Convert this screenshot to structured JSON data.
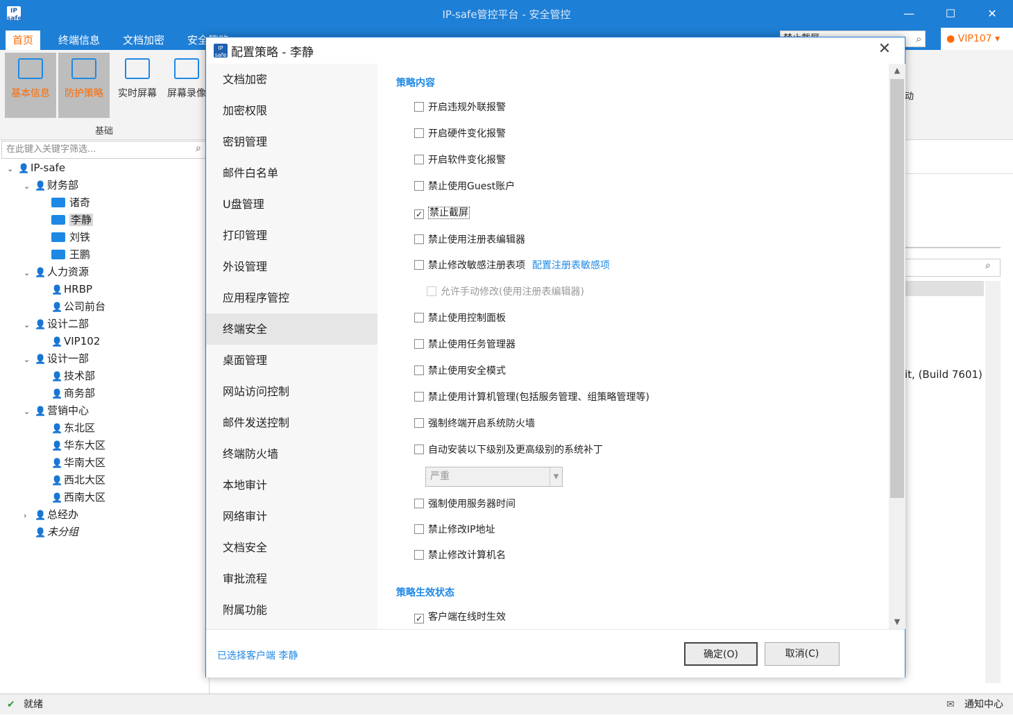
{
  "window": {
    "title": "IP-safe管控平台 - 安全管控",
    "logo": "IP safe"
  },
  "menu_tabs": [
    {
      "label": "首页"
    },
    {
      "label": "终端信息"
    },
    {
      "label": "文档加密"
    },
    {
      "label": "安全策略"
    }
  ],
  "search": {
    "value": "禁止截屏"
  },
  "user": {
    "label": "VIP107 ▾"
  },
  "ribbon": {
    "buttons": [
      "基本信息",
      "防护策略",
      "实时屏幕",
      "屏幕录像"
    ],
    "group_label": "基础"
  },
  "filter": {
    "placeholder": "在此键入关键字筛选..."
  },
  "tree": [
    {
      "label": "IP-safe",
      "kind": "group",
      "arrow": "⌄"
    },
    {
      "label": "财务部",
      "kind": "group",
      "arrow": "⌄"
    },
    {
      "label": "诸奇",
      "kind": "pc"
    },
    {
      "label": "李静",
      "kind": "pc"
    },
    {
      "label": "刘铁",
      "kind": "pc"
    },
    {
      "label": "王鹏",
      "kind": "pc"
    },
    {
      "label": "人力资源",
      "kind": "group",
      "arrow": "⌄"
    },
    {
      "label": "HRBP",
      "kind": "user"
    },
    {
      "label": "公司前台",
      "kind": "user"
    },
    {
      "label": "设计二部",
      "kind": "group",
      "arrow": "⌄"
    },
    {
      "label": "VIP102",
      "kind": "user"
    },
    {
      "label": "设计一部",
      "kind": "group",
      "arrow": "⌄"
    },
    {
      "label": "技术部",
      "kind": "user"
    },
    {
      "label": "商务部",
      "kind": "user"
    },
    {
      "label": "营销中心",
      "kind": "group",
      "arrow": "⌄"
    },
    {
      "label": "东北区",
      "kind": "user"
    },
    {
      "label": "华东大区",
      "kind": "user"
    },
    {
      "label": "华南大区",
      "kind": "user"
    },
    {
      "label": "西北大区",
      "kind": "user"
    },
    {
      "label": "西南大区",
      "kind": "user"
    },
    {
      "label": "总经办",
      "kind": "group",
      "arrow": "›"
    },
    {
      "label": "未分组",
      "kind": "group"
    }
  ],
  "right_pane": {
    "fragment": "it, (Build 7601)",
    "ribbon_fragment": "动"
  },
  "dialog": {
    "title": "配置策略 - 李静",
    "close": "✕",
    "nav": [
      "文档加密",
      "加密权限",
      "密钥管理",
      "邮件白名单",
      "U盘管理",
      "打印管理",
      "外设管理",
      "应用程序管控",
      "终端安全",
      "桌面管理",
      "网站访问控制",
      "邮件发送控制",
      "终端防火墙",
      "本地审计",
      "网络审计",
      "文档安全",
      "审批流程",
      "附属功能"
    ],
    "active_nav": "终端安全",
    "section_content": "策略内容",
    "options": [
      {
        "label": "开启违规外联报警",
        "checked": false
      },
      {
        "label": "开启硬件变化报警",
        "checked": false
      },
      {
        "label": "开启软件变化报警",
        "checked": false
      },
      {
        "label": "禁止使用Guest账户",
        "checked": false
      },
      {
        "label": "禁止截屏",
        "checked": true
      },
      {
        "label": "禁止使用注册表编辑器",
        "checked": false
      },
      {
        "label": "禁止修改敏感注册表项",
        "checked": false,
        "link": "配置注册表敏感项"
      },
      {
        "label": "允许手动修改(使用注册表编辑器)",
        "checked": false,
        "disabled": true
      },
      {
        "label": "禁止使用控制面板",
        "checked": false
      },
      {
        "label": "禁止使用任务管理器",
        "checked": false
      },
      {
        "label": "禁止使用安全模式",
        "checked": false
      },
      {
        "label": "禁止使用计算机管理(包括服务管理、组策略管理等)",
        "checked": false
      },
      {
        "label": "强制终端开启系统防火墙",
        "checked": false
      },
      {
        "label": "自动安装以下级别及更高级别的系统补丁",
        "checked": false
      },
      {
        "label": "强制使用服务器时间",
        "checked": false
      },
      {
        "label": "禁止修改IP地址",
        "checked": false
      },
      {
        "label": "禁止修改计算机名",
        "checked": false
      }
    ],
    "patch_level": "严重",
    "section_status": "策略生效状态",
    "status_option": {
      "label": "客户端在线时生效",
      "checked": true
    },
    "selected_client": "已选择客户端 李静",
    "ok": "确定(O)",
    "cancel": "取消(C)"
  },
  "statusbar": {
    "status": "就绪",
    "notify": "通知中心"
  },
  "colors": {
    "accent": "#1e7fd6",
    "active_tab": "#ff6a00",
    "link": "#1e88e5"
  }
}
